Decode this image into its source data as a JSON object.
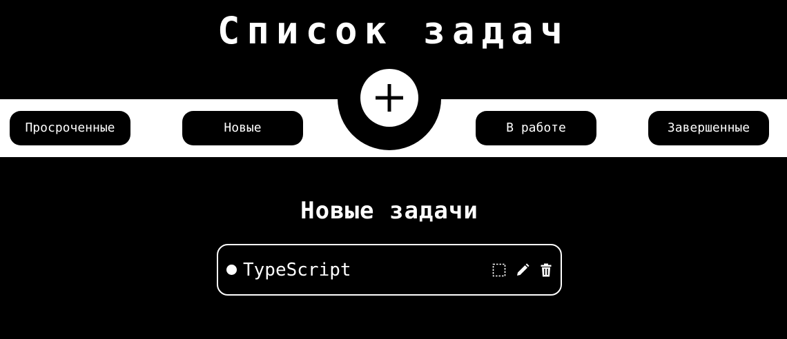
{
  "header": {
    "title": "Список задач"
  },
  "filters": [
    {
      "label": "Просроченные"
    },
    {
      "label": "Новые"
    },
    {
      "label": "В работе"
    },
    {
      "label": "Завершенные"
    }
  ],
  "add_button": {
    "icon": "plus-icon"
  },
  "section": {
    "title": "Новые задачи"
  },
  "tasks": [
    {
      "title": "TypeScript",
      "actions": [
        "select-icon",
        "pencil-icon",
        "trash-icon"
      ]
    }
  ],
  "colors": {
    "background": "#000000",
    "foreground": "#ffffff"
  }
}
